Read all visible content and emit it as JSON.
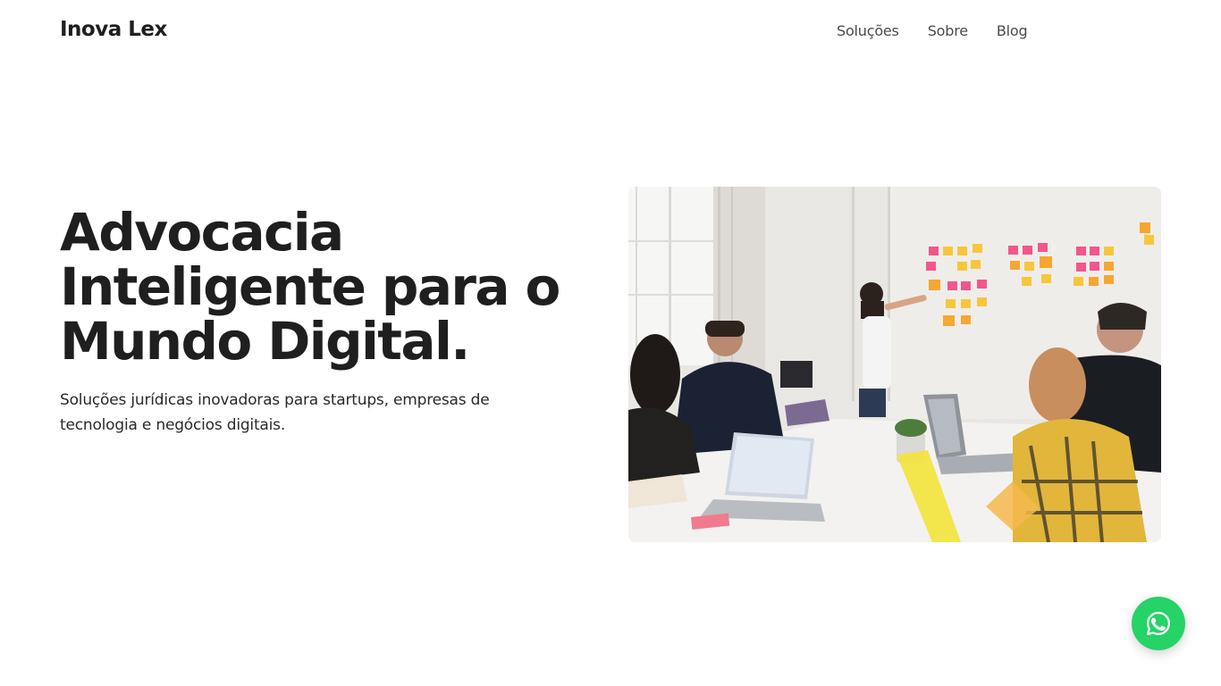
{
  "header": {
    "logo": "Inova Lex",
    "nav": [
      {
        "label": "Soluções"
      },
      {
        "label": "Sobre"
      },
      {
        "label": "Blog"
      }
    ]
  },
  "hero": {
    "title_lines": [
      "Advocacia",
      "Inteligente para o",
      "Mundo Digital."
    ],
    "subtitle": "Soluções jurídicas inovadoras para startups, empresas de tecnologia e negócios digitais.",
    "image": "office-team-meeting-photo"
  },
  "floating": {
    "icon": "whatsapp-icon",
    "color": "#25d366"
  }
}
